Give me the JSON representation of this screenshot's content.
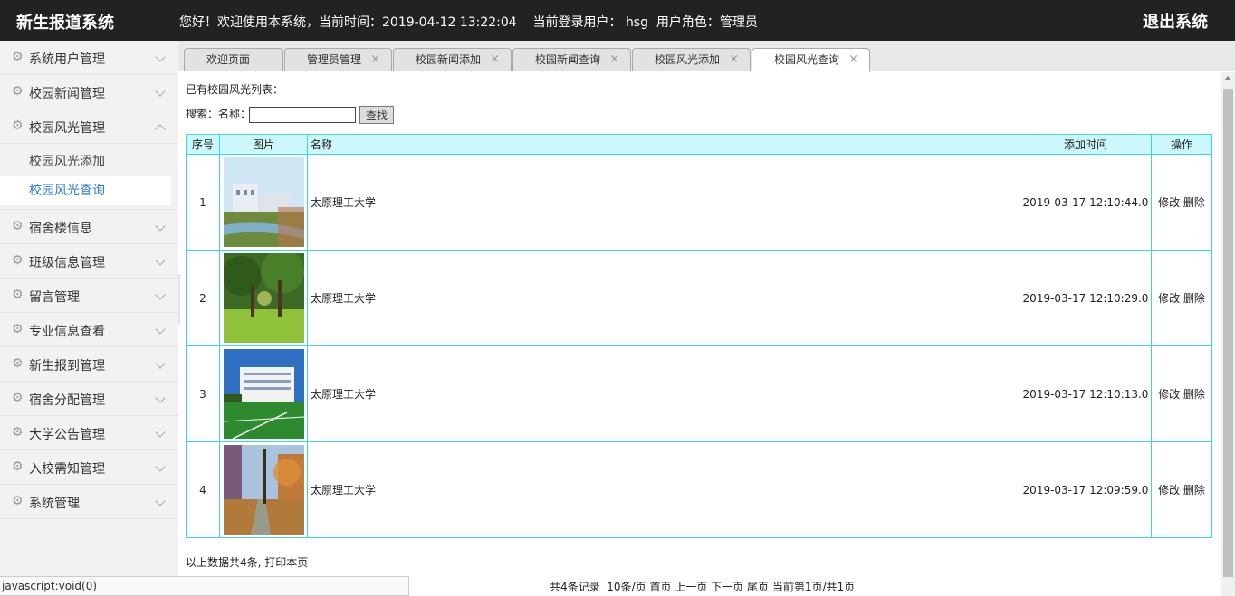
{
  "header": {
    "title": "新生报道系统",
    "welcome": "您好！欢迎使用本系统，当前时间：2019-04-12 13:22:04    当前登录用户： hsg  用户角色：管理员",
    "logout": "退出系统"
  },
  "sidebar": {
    "items": [
      {
        "label": "系统用户管理"
      },
      {
        "label": "校园新闻管理"
      },
      {
        "label": "校园风光管理"
      },
      {
        "label": "宿舍楼信息"
      },
      {
        "label": "班级信息管理"
      },
      {
        "label": "留言管理"
      },
      {
        "label": "专业信息查看"
      },
      {
        "label": "新生报到管理"
      },
      {
        "label": "宿舍分配管理"
      },
      {
        "label": "大学公告管理"
      },
      {
        "label": "入校需知管理"
      },
      {
        "label": "系统管理"
      }
    ],
    "submenu": [
      {
        "label": "校园风光添加"
      },
      {
        "label": "校园风光查询"
      }
    ]
  },
  "tabs": [
    {
      "label": "欢迎页面",
      "close": ""
    },
    {
      "label": "管理员管理",
      "close": "×"
    },
    {
      "label": "校园新闻添加",
      "close": "×"
    },
    {
      "label": "校园新闻查询",
      "close": "×"
    },
    {
      "label": "校园风光添加",
      "close": "×"
    },
    {
      "label": "校园风光查询",
      "close": "×"
    }
  ],
  "content": {
    "caption": "已有校园风光列表：",
    "search_label": "搜索：名称：",
    "search_value": "",
    "find_button": "查找",
    "columns": [
      "序号",
      "图片",
      "名称",
      "添加时间",
      "操作"
    ],
    "rows": [
      {
        "no": "1",
        "name": "太原理工大学",
        "time": "2019-03-17 12:10:44.0",
        "edit": "修改",
        "del": "删除"
      },
      {
        "no": "2",
        "name": "太原理工大学",
        "time": "2019-03-17 12:10:29.0",
        "edit": "修改",
        "del": "删除"
      },
      {
        "no": "3",
        "name": "太原理工大学",
        "time": "2019-03-17 12:10:13.0",
        "edit": "修改",
        "del": "删除"
      },
      {
        "no": "4",
        "name": "太原理工大学",
        "time": "2019-03-17 12:09:59.0",
        "edit": "修改",
        "del": "删除"
      }
    ],
    "summary": "以上数据共4条,",
    "print": "打印本页",
    "pager": {
      "total": "共4条记录",
      "per_page": "10条/页",
      "first": "首页",
      "prev": "上一页",
      "next": "下一页",
      "last": "尾页",
      "current": "当前第1页/共1页"
    }
  },
  "status": "javascript:void(0)",
  "colors": {
    "header_bg": "#222222",
    "table_border": "#3cd6de",
    "table_head_bg": "#ccf8fb",
    "active_link": "#2a7ad6"
  }
}
